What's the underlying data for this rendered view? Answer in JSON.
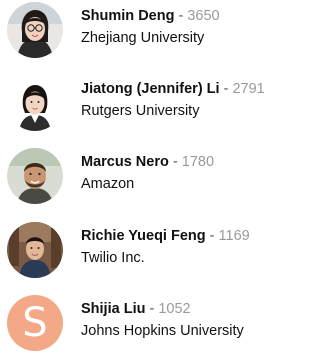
{
  "users": [
    {
      "name": "Shumin Deng",
      "separator": "-",
      "score": "3650",
      "organization": "Zhejiang University"
    },
    {
      "name": "Jiatong (Jennifer) Li",
      "separator": "-",
      "score": "2791",
      "organization": "Rutgers University"
    },
    {
      "name": "Marcus Nero",
      "separator": "-",
      "score": "1780",
      "organization": "Amazon"
    },
    {
      "name": "Richie Yueqi Feng",
      "separator": "-",
      "score": "1169",
      "organization": "Twilio Inc."
    },
    {
      "name": "Shijia Liu",
      "separator": "-",
      "score": "1052",
      "organization": "Johns Hopkins University",
      "avatar_letter": "S"
    }
  ],
  "colors": {
    "letter_avatar_bg": "#f3a888",
    "score": "#9a9a9a",
    "name": "#111111"
  }
}
